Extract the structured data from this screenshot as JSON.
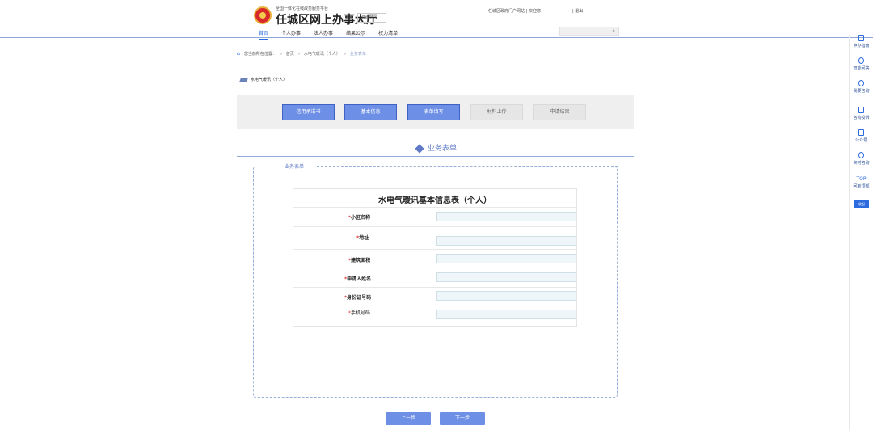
{
  "header": {
    "subtitle": "全国一体化在线政务服务平台",
    "title": "任城区网上办事大厅",
    "region": "任城区 ∨",
    "portal_links": "任城区政府门户网站  |  欢迎您",
    "logout": "|  退出",
    "nav": [
      "首页",
      "个人办事",
      "法人办事",
      "结果公示",
      "权力清单"
    ]
  },
  "breadcrumb": {
    "prefix": "您当前所在位置：",
    "items": [
      "首页",
      "水电气暖讯（个人）",
      "业务表单"
    ]
  },
  "section_title": "水电气暖讯（个人）",
  "steps": [
    {
      "label": "信用承诺书",
      "active": true
    },
    {
      "label": "基本信息",
      "active": true
    },
    {
      "label": "表单填写",
      "active": true
    },
    {
      "label": "材料上传",
      "active": false
    },
    {
      "label": "申请结果",
      "active": false
    }
  ],
  "form": {
    "heading": "业务表单",
    "legend": "业务表单",
    "table_title": "水电气暖讯基本信息表（个人）",
    "fields": [
      {
        "label": "小区名称",
        "value": ""
      },
      {
        "label": "地址",
        "value": ""
      },
      {
        "label": "建筑面积",
        "value": ""
      },
      {
        "label": "申请人姓名",
        "value": ""
      },
      {
        "label": "身份证号码",
        "value": ""
      },
      {
        "label": "手机号码",
        "value": ""
      }
    ],
    "required_mark": "*"
  },
  "buttons": {
    "prev": "上一步",
    "next": "下一步"
  },
  "sidebar": {
    "items": [
      "申办指南",
      "智能问答",
      "我要咨询",
      "咨询投诉",
      "公众号",
      "实时咨询",
      "回到顶部"
    ],
    "top_label": "TOP",
    "collapse": "收起"
  },
  "colors": {
    "accent": "#6d8fe5",
    "primary": "#2d6cdf",
    "required": "#e03a3a"
  }
}
